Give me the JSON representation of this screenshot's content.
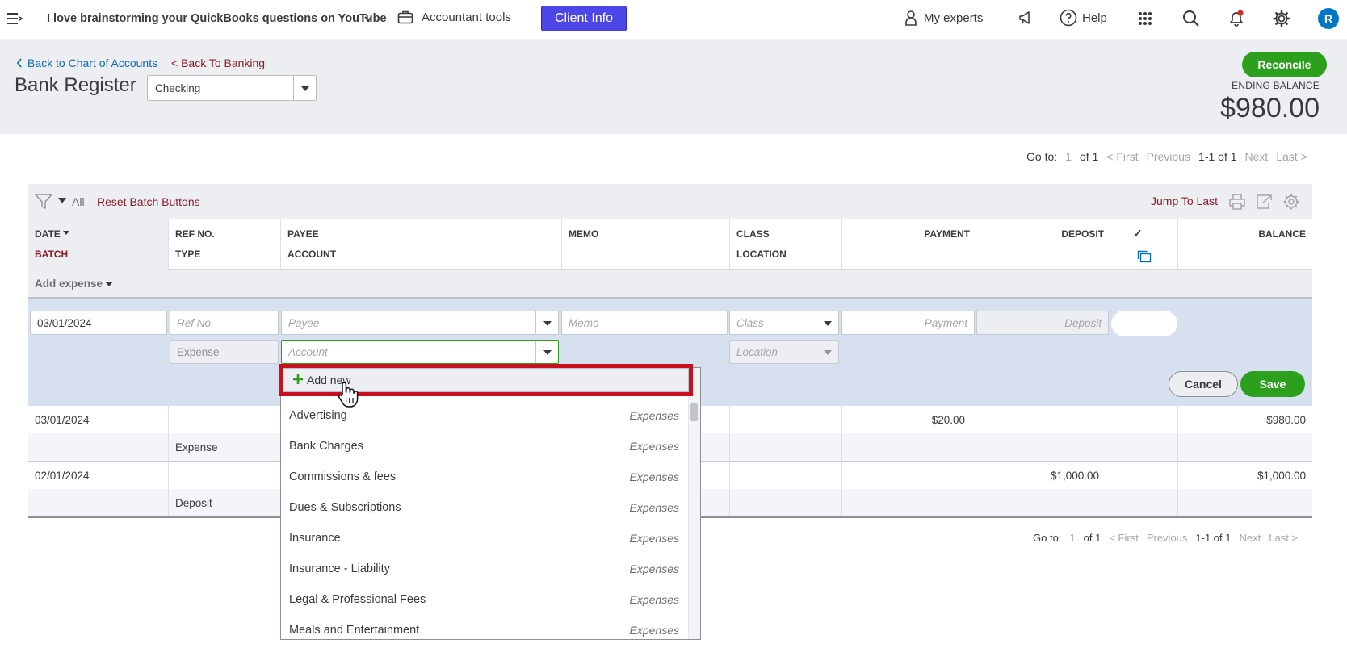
{
  "topbar": {
    "company_name": "I love brainstorming your QuickBooks questions on YouTube",
    "accountant_tools": "Accountant tools",
    "client_info": "Client Info",
    "my_experts": "My experts",
    "help": "Help",
    "avatar_initial": "R",
    "icons": [
      "menu-icon",
      "chevron-down-icon",
      "briefcase-icon",
      "person-icon",
      "megaphone-icon",
      "help-icon",
      "apps-grid-icon",
      "search-icon",
      "bell-icon",
      "gear-icon"
    ]
  },
  "header": {
    "back_chart": "Back to Chart of Accounts",
    "back_banking": "< Back To Banking",
    "title": "Bank Register",
    "account_selected": "Checking",
    "reconcile": "Reconcile",
    "ending_balance_label": "ENDING BALANCE",
    "ending_balance": "$980.00"
  },
  "pager": {
    "goto": "Go to:",
    "page": "1",
    "of": "of 1",
    "first": "< First",
    "previous": "Previous",
    "range": "1-1 of 1",
    "next": "Next",
    "last": "Last >"
  },
  "toolbar": {
    "filter_all": "All",
    "reset_batch": "Reset Batch Buttons",
    "jump_to_last": "Jump To Last"
  },
  "columns": {
    "date": "DATE",
    "batch": "BATCH",
    "ref_no": "REF NO.",
    "type": "TYPE",
    "payee": "PAYEE",
    "account": "ACCOUNT",
    "memo": "MEMO",
    "class": "CLASS",
    "location": "LOCATION",
    "payment": "PAYMENT",
    "deposit": "DEPOSIT",
    "check": "✓",
    "balance": "BALANCE"
  },
  "add_expense": "Add expense",
  "edit_row": {
    "date_value": "03/01/2024",
    "ref_placeholder": "Ref No.",
    "payee_placeholder": "Payee",
    "memo_placeholder": "Memo",
    "class_placeholder": "Class",
    "payment_placeholder": "Payment",
    "deposit_placeholder": "Deposit",
    "type_value": "Expense",
    "account_placeholder": "Account",
    "location_placeholder": "Location",
    "cancel": "Cancel",
    "save": "Save"
  },
  "rows": [
    {
      "date": "03/01/2024",
      "type": "Expense",
      "payment": "$20.00",
      "deposit": "",
      "balance": "$980.00"
    },
    {
      "date": "02/01/2024",
      "type": "Deposit",
      "payment": "",
      "deposit": "$1,000.00",
      "balance": "$1,000.00"
    }
  ],
  "account_dropdown": {
    "add_new": "Add new",
    "items": [
      {
        "name": "Advertising",
        "type": "Expenses"
      },
      {
        "name": "Bank Charges",
        "type": "Expenses"
      },
      {
        "name": "Commissions & fees",
        "type": "Expenses"
      },
      {
        "name": "Dues & Subscriptions",
        "type": "Expenses"
      },
      {
        "name": "Insurance",
        "type": "Expenses"
      },
      {
        "name": "Insurance - Liability",
        "type": "Expenses"
      },
      {
        "name": "Legal & Professional Fees",
        "type": "Expenses"
      },
      {
        "name": "Meals and Entertainment",
        "type": "Expenses"
      }
    ]
  },
  "colors": {
    "brand_green": "#2ca01c",
    "client_info_bg": "#4c46e6",
    "link_blue": "#0d6db3",
    "link_red": "#8d1c27",
    "highlight_red": "#c8101e",
    "edit_row_bg": "#d7e0ef"
  }
}
